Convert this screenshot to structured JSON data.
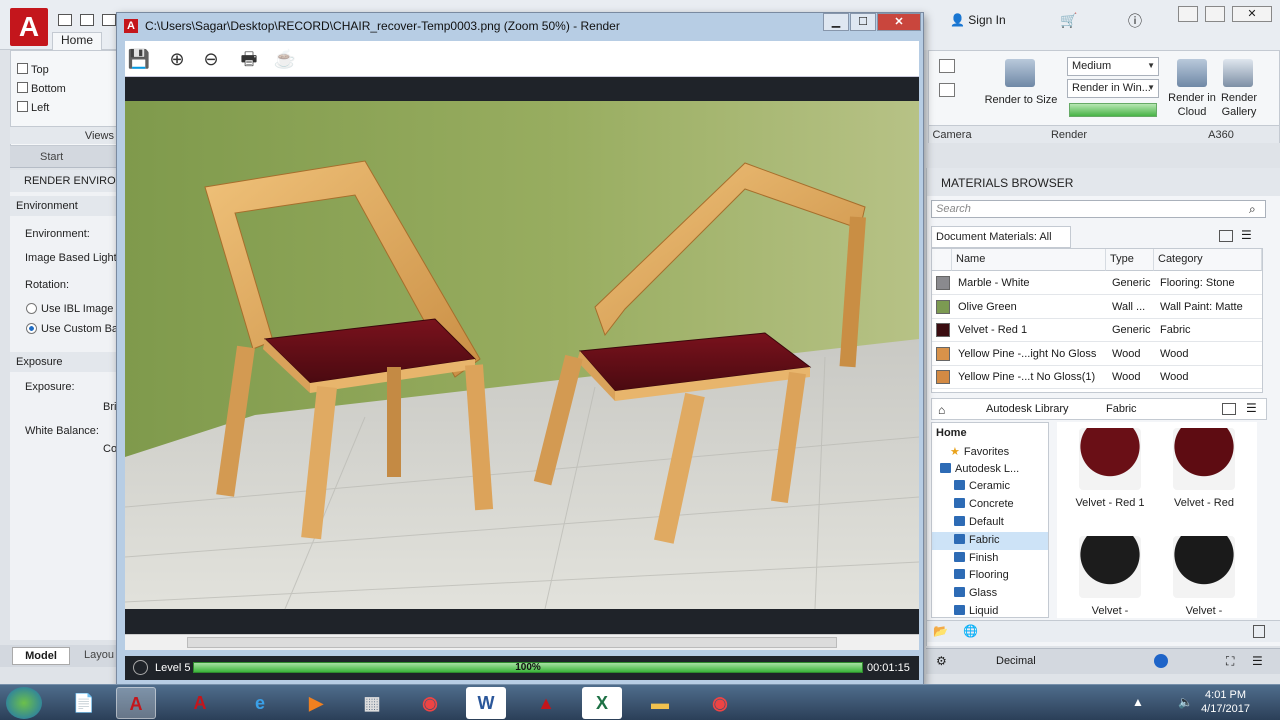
{
  "app": {
    "home_tab": "Home",
    "views_panel": {
      "items": [
        "Top",
        "Bottom",
        "Left"
      ],
      "label": "Views"
    },
    "start_tab": "Start",
    "sign_in": "Sign In"
  },
  "render_environment": {
    "header": "RENDER ENVIRONME",
    "environment_section": "Environment",
    "environment_label": "Environment:",
    "ibl_label": "Image Based Lighti",
    "rotation_label": "Rotation:",
    "use_ibl": "Use IBL Image",
    "use_custom": "Use Custom Ba",
    "exposure_section": "Exposure",
    "exposure_label": "Exposure:",
    "brightness": "Bri",
    "white_balance_label": "White Balance:",
    "cool": "Co"
  },
  "bottom_tabs": {
    "model": "Model",
    "layout": "Layou"
  },
  "ribbon_right": {
    "render_to_size": "Render to Size",
    "quality": "Medium",
    "render_in": "Render in Win...",
    "render_in_cloud": "Render in Cloud",
    "render_gallery": "Render Gallery",
    "camera": "Camera",
    "render": "Render",
    "a360": "A360"
  },
  "render_window": {
    "title": "C:\\Users\\Sagar\\Desktop\\RECORD\\CHAIR_recover-Temp0003.png (Zoom 50%) - Render",
    "level": "Level 5",
    "progress": "100%",
    "progress_fraction": 1.0,
    "elapsed": "00:01:15"
  },
  "materials_browser": {
    "title": "MATERIALS BROWSER",
    "search_placeholder": "Search",
    "doc_filter": "Document Materials: All",
    "columns": [
      "Name",
      "Type",
      "Category"
    ],
    "rows": [
      {
        "name": "Marble - White",
        "type": "Generic",
        "category": "Flooring: Stone",
        "swatch": "#8a8a8e"
      },
      {
        "name": "Olive Green",
        "type": "Wall ...",
        "category": "Wall Paint: Matte",
        "swatch": "#7c9a52"
      },
      {
        "name": "Velvet - Red 1",
        "type": "Generic",
        "category": "Fabric",
        "swatch": "#3a0c10"
      },
      {
        "name": "Yellow Pine -...ight No Gloss",
        "type": "Wood",
        "category": "Wood",
        "swatch": "#d8924a"
      },
      {
        "name": "Yellow Pine -...t No Gloss(1)",
        "type": "Wood",
        "category": "Wood",
        "swatch": "#d38a44"
      }
    ],
    "library_path": [
      "Autodesk Library",
      "Fabric"
    ],
    "tree": [
      "Home",
      "Favorites",
      "Autodesk L...",
      "Ceramic",
      "Concrete",
      "Default",
      "Fabric",
      "Finish",
      "Flooring",
      "Glass",
      "Liquid"
    ],
    "selected_tree": "Fabric",
    "thumbnails": [
      {
        "label": "Velvet - Red 1",
        "color": "#6a0f16"
      },
      {
        "label": "Velvet - Red",
        "color": "#5e0c12"
      },
      {
        "label": "Velvet -",
        "color": "#1c1c1c"
      },
      {
        "label": "Velvet -",
        "color": "#1a1a1a"
      }
    ],
    "units": "Decimal"
  },
  "taskbar": {
    "time": "4:01 PM",
    "date": "4/17/2017"
  },
  "colors": {
    "autocad_red": "#c4161c",
    "progress_green": "#3bb43a",
    "wall": "#8fa45a"
  }
}
